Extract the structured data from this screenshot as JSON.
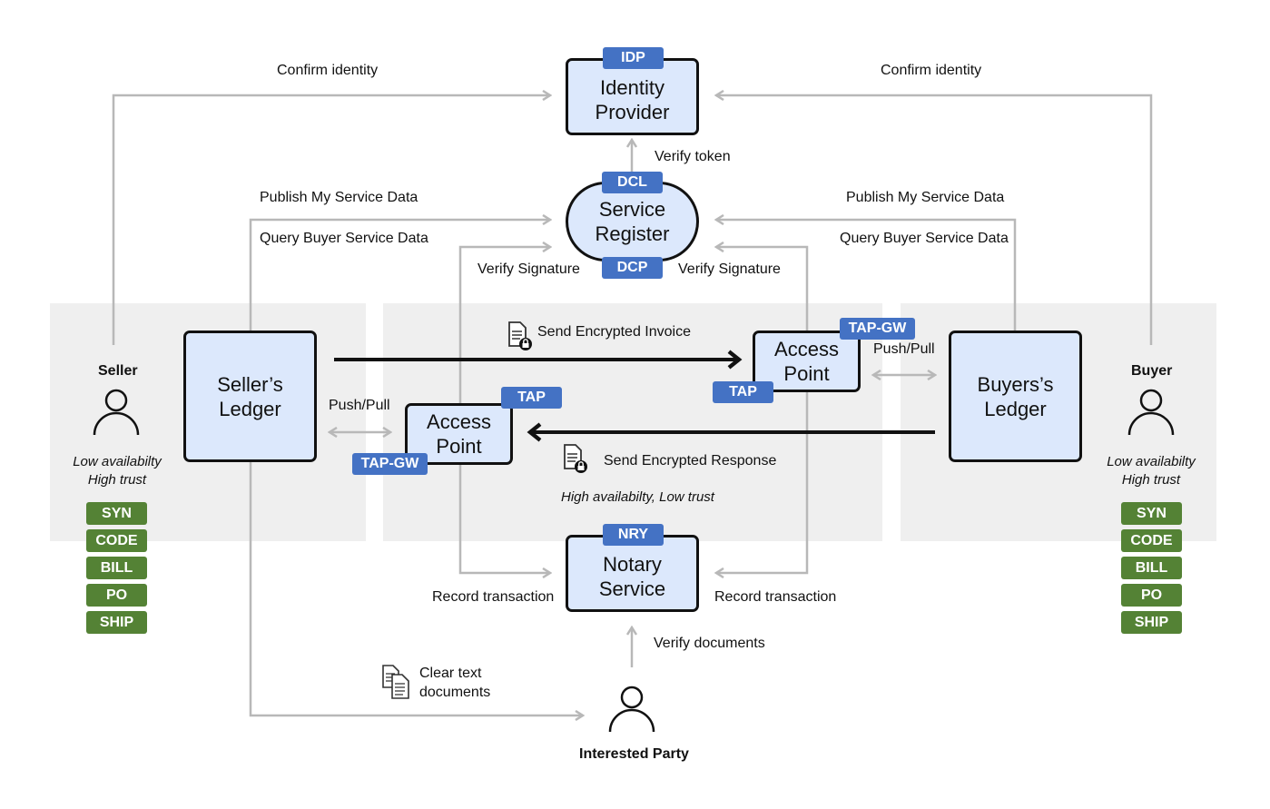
{
  "nodes": {
    "idp": {
      "tag": "IDP",
      "line1": "Identity",
      "line2": "Provider"
    },
    "register": {
      "top_tag": "DCL",
      "bottom_tag": "DCP",
      "line1": "Service",
      "line2": "Register"
    },
    "sellers_ledger": {
      "line1": "Seller’s",
      "line2": "Ledger"
    },
    "buyers_ledger": {
      "line1": "Buyers’s",
      "line2": "Ledger"
    },
    "access_point_left": {
      "line1": "Access",
      "line2": "Point",
      "tag_top": "TAP",
      "tag_bottom": "TAP-GW"
    },
    "access_point_right": {
      "line1": "Access",
      "line2": "Point",
      "tag_top": "TAP-GW",
      "tag_bottom": "TAP"
    },
    "notary": {
      "tag": "NRY",
      "line1": "Notary",
      "line2": "Service"
    }
  },
  "actors": {
    "seller": {
      "name": "Seller",
      "desc1": "Low availabilty",
      "desc2": "High trust",
      "tags": [
        "SYN",
        "CODE",
        "BILL",
        "PO",
        "SHIP"
      ]
    },
    "buyer": {
      "name": "Buyer",
      "desc1": "Low availabilty",
      "desc2": "High trust",
      "tags": [
        "SYN",
        "CODE",
        "BILL",
        "PO",
        "SHIP"
      ]
    },
    "interested_party": {
      "name": "Interested Party"
    }
  },
  "labels": {
    "confirm_left": "Confirm identity",
    "confirm_right": "Confirm identity",
    "verify_token": "Verify token",
    "publish_left": "Publish My Service Data",
    "query_left": "Query Buyer Service Data",
    "publish_right": "Publish My Service Data",
    "query_right": "Query Buyer Service Data",
    "verify_sig_left": "Verify Signature",
    "verify_sig_right": "Verify Signature",
    "send_invoice": "Send Encrypted Invoice",
    "send_response": "Send Encrypted Response",
    "push_pull_left": "Push/Pull",
    "push_pull_right": "Push/Pull",
    "middle_zone": "High availabilty, Low trust",
    "record_left": "Record transaction",
    "record_right": "Record transaction",
    "verify_documents": "Verify documents",
    "clear_text_1": "Clear text",
    "clear_text_2": "documents"
  },
  "colors": {
    "node_fill": "#dce8fc",
    "tag_blue": "#4472c4",
    "tag_green": "#548235",
    "zone_gray": "#efefef",
    "arrow_gray": "#b8b8b8"
  }
}
